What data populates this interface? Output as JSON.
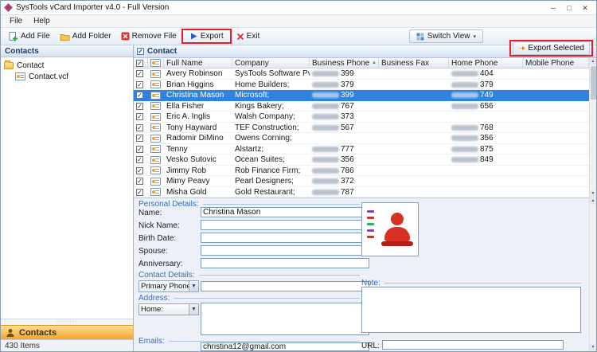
{
  "colors": {
    "selection_blue": "#2f82dd",
    "annotation_red": "#ec1c24",
    "contacts_tab_orange": "#f4a62a"
  },
  "window": {
    "title": "SysTools vCard Importer v4.0 - Full Version",
    "controls": {
      "minimize": "─",
      "maximize": "□",
      "close": "✕"
    }
  },
  "menubar": {
    "items": [
      "File",
      "Help"
    ]
  },
  "toolbar": {
    "add_file": "Add File",
    "add_folder": "Add Folder",
    "remove_file": "Remove File",
    "export": "Export",
    "exit": "Exit",
    "switch_view": "Switch View"
  },
  "sidebar": {
    "header": "Contacts",
    "tree_root": "Contact",
    "tree_child": "Contact.vcf",
    "bottom_tab": "Contacts",
    "status": "430 Items"
  },
  "content": {
    "header": "Contact",
    "export_selected": "Export Selected",
    "table": {
      "columns": [
        "Full Name",
        "Company",
        "Business Phone",
        "Business Fax",
        "Home Phone",
        "Mobile Phone"
      ],
      "rows": [
        {
          "full_name": "Avery Robinson",
          "company": "SysTools Software Pvt. Ltd.;",
          "business_phone": "399",
          "business_fax": "",
          "home_phone": "404",
          "mobile_phone": "",
          "selected": false
        },
        {
          "full_name": "Brian Higgins",
          "company": "Home Builders;",
          "business_phone": "379",
          "business_fax": "",
          "home_phone": "379",
          "mobile_phone": "",
          "selected": false
        },
        {
          "full_name": "Christina Mason",
          "company": "Microsoft;",
          "business_phone": "399",
          "business_fax": "",
          "home_phone": "749",
          "mobile_phone": "",
          "selected": true
        },
        {
          "full_name": "Ella Fisher",
          "company": "Kings Bakery;",
          "business_phone": "767",
          "business_fax": "",
          "home_phone": "656",
          "mobile_phone": "",
          "selected": false
        },
        {
          "full_name": "Eric A. Inglis",
          "company": "Walsh Company;",
          "business_phone": "373",
          "business_fax": "",
          "home_phone": "",
          "mobile_phone": "",
          "selected": false
        },
        {
          "full_name": "Tony Hayward",
          "company": "TEF Construction;",
          "business_phone": "567",
          "business_fax": "",
          "home_phone": "768",
          "mobile_phone": "",
          "selected": false
        },
        {
          "full_name": "Radomir DiMino",
          "company": "Owens Corning;",
          "business_phone": "",
          "business_fax": "",
          "home_phone": "356",
          "mobile_phone": "",
          "selected": false
        },
        {
          "full_name": "Tenny",
          "company": "Alstartz;",
          "business_phone": "777",
          "business_fax": "",
          "home_phone": "875",
          "mobile_phone": "",
          "selected": false
        },
        {
          "full_name": "Vesko Sutovic",
          "company": "Ocean Suites;",
          "business_phone": "356",
          "business_fax": "",
          "home_phone": "849",
          "mobile_phone": "",
          "selected": false
        },
        {
          "full_name": "Jimmy Rob",
          "company": "Rob Finance Firm;",
          "business_phone": "786",
          "business_fax": "",
          "home_phone": "",
          "mobile_phone": "",
          "selected": false
        },
        {
          "full_name": "Mimy Peavy",
          "company": "Pearl Designers;",
          "business_phone": "372",
          "business_fax": "",
          "home_phone": "",
          "mobile_phone": "",
          "selected": false
        },
        {
          "full_name": "Misha Gold",
          "company": "Gold Restaurant;",
          "business_phone": "787",
          "business_fax": "",
          "home_phone": "",
          "mobile_phone": "",
          "selected": false
        }
      ]
    }
  },
  "details": {
    "personal_label": "Personal Details:",
    "fields": [
      {
        "label": "Name:",
        "value": "Christina Mason"
      },
      {
        "label": "Nick Name:",
        "value": ""
      },
      {
        "label": "Birth Date:",
        "value": ""
      },
      {
        "label": "Spouse:",
        "value": ""
      },
      {
        "label": "Anniversary:",
        "value": ""
      }
    ],
    "contact_label": "Contact Details:",
    "primary_phone_option": "Primary Phone:",
    "primary_phone_value": "",
    "address_label": "Address:",
    "home_option": "Home:",
    "address_value": "",
    "emails_label": "Emails:",
    "email_value": "christina12@gmail.com",
    "note_label": "Note:",
    "note_value": "",
    "url_label": "URL:",
    "url_value": ""
  }
}
